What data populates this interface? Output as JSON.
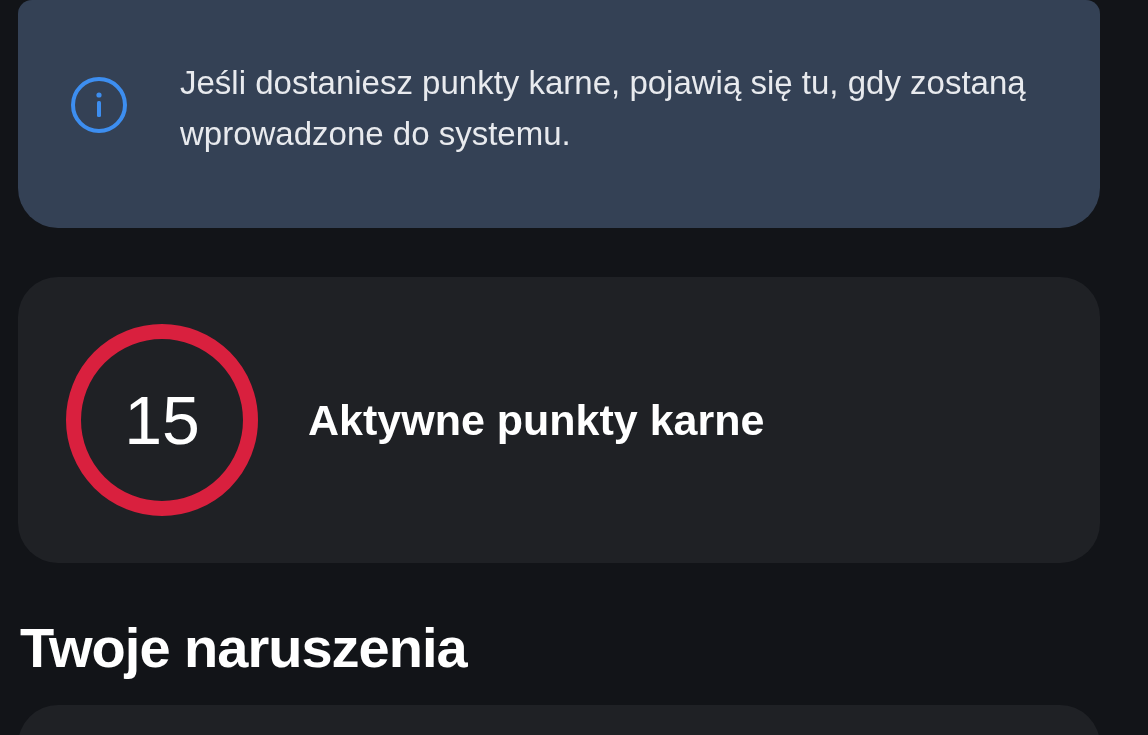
{
  "info_banner": {
    "text": "Jeśli dostaniesz punkty karne, pojawią się tu, gdy zostaną wprowadzone do systemu."
  },
  "points_card": {
    "count": "15",
    "label": "Aktywne punkty karne"
  },
  "section_heading": "Twoje naruszenia"
}
